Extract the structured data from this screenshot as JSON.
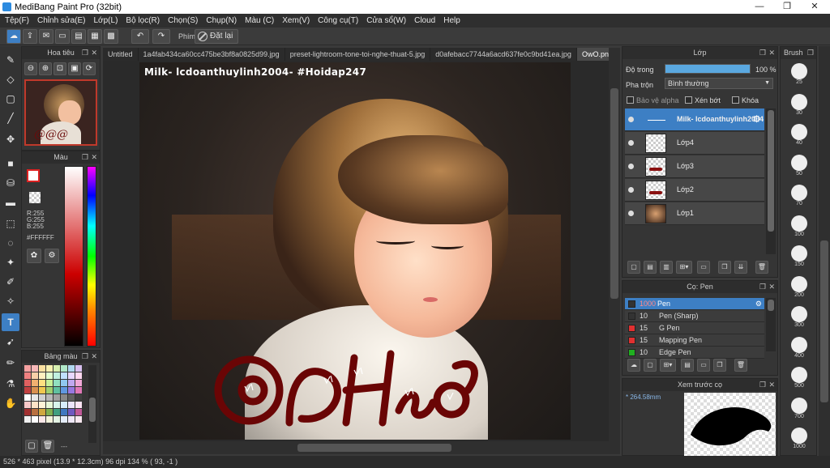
{
  "window": {
    "title": "MediBang Paint Pro (32bit)"
  },
  "menu": [
    "Tệp(F)",
    "Chỉnh sửa(E)",
    "Lớp(L)",
    "Bộ lọc(R)",
    "Chọn(S)",
    "Chụp(N)",
    "Màu (C)",
    "Xem(V)",
    "Công cụ(T)",
    "Cửa sổ(W)",
    "Cloud",
    "Help"
  ],
  "toolbar": {
    "shortcut_label": "Phím",
    "reset_label": "Đặt lại"
  },
  "navigator": {
    "title": "Hoa tiêu"
  },
  "color": {
    "title": "Màu",
    "r": "R:255",
    "g": "G:255",
    "b": "B:255",
    "hex": "#FFFFFF",
    "fg": "#ffffff"
  },
  "palette": {
    "title": "Bảng màu",
    "extra": "---",
    "swatches": [
      "#f5a0a0",
      "#f7b8b8",
      "#fbe0a0",
      "#f8f0b0",
      "#d8f0b0",
      "#b0e8c8",
      "#b0d8f0",
      "#d8c0f0",
      "#f08080",
      "#f8d0a8",
      "#fff0c0",
      "#e0ffd0",
      "#c0f0e0",
      "#c0e0ff",
      "#e8d8ff",
      "#ffd8f0",
      "#e06060",
      "#f0b070",
      "#ffe080",
      "#c8f098",
      "#90e0c0",
      "#90c8f0",
      "#c0a8f0",
      "#f0a8d8",
      "#c04040",
      "#d89050",
      "#f0c850",
      "#a0d070",
      "#60c0a0",
      "#6098e0",
      "#9878e0",
      "#e078b8",
      "#ffffff",
      "#e8e8e8",
      "#d0d0d0",
      "#b8b8b8",
      "#a0a0a0",
      "#888888",
      "#606060",
      "#404040",
      "#f8c8c8",
      "#fde4c8",
      "#fff4d8",
      "#e8f8d8",
      "#d8f4ec",
      "#d8ecfc",
      "#ece4fc",
      "#fce4f4",
      "#a03030",
      "#b87040",
      "#d0a840",
      "#80b050",
      "#40a080",
      "#4078c0",
      "#7058c0",
      "#c05898",
      "#f0f0f0",
      "#ffffff",
      "#fce8e8",
      "#f4f4dc",
      "#e4f4e4",
      "#e4ecf8",
      "#f0e8f8",
      "#f8e8f0"
    ]
  },
  "tabs": [
    "Untitled",
    "1a4fab434ca60cc475be3bf8a0825d99.jpg",
    "preset-lightroom-tone-toi-nghe-thuat-5.jpg",
    "d0afebacc7744a6acd637fe0c9bd41ea.jpg",
    "OwO.png"
  ],
  "canvas": {
    "watermark": "Milk- lcdoanthuylinh2004- #Hoidap247"
  },
  "status": {
    "text": "526 * 463 pixel   (13.9 * 12.3cm)   96 dpi   134 %   ( 93, -1 )"
  },
  "layers": {
    "title": "Lớp",
    "opacity_label": "Độ trong",
    "opacity_value": "100 %",
    "opacity_fraction": 1.0,
    "blend_label": "Pha trộn",
    "blend_value": "Bình thường",
    "protect_alpha": "Bảo vệ alpha",
    "clipping": "Xén bớt",
    "lock": "Khóa",
    "items": [
      "Milk- lcdoanthuylinh2004",
      "Lớp4",
      "Lớp3",
      "Lớp2",
      "Lớp1"
    ]
  },
  "brushes": {
    "title": "Cọ: Pen",
    "items": [
      {
        "size": "1000",
        "name": "Pen",
        "color": "#333333"
      },
      {
        "size": "10",
        "name": "Pen (Sharp)",
        "color": "#333333"
      },
      {
        "size": "15",
        "name": "G Pen",
        "color": "#e03030"
      },
      {
        "size": "15",
        "name": "Mapping Pen",
        "color": "#e03030"
      },
      {
        "size": "10",
        "name": "Edge Pen",
        "color": "#20b020"
      }
    ]
  },
  "preview": {
    "title": "Xem trước cọ",
    "size": "* 264.58mm"
  },
  "brush_sizes": {
    "title": "Brush",
    "values": [
      "25",
      "30",
      "40",
      "50",
      "70",
      "100",
      "150",
      "200",
      "300",
      "400",
      "500",
      "700",
      "1000"
    ]
  }
}
